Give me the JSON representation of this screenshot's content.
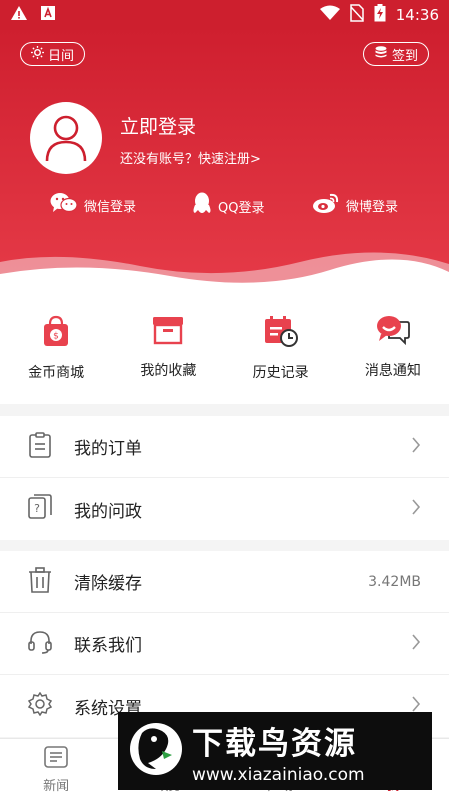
{
  "status_bar": {
    "time": "14:36"
  },
  "header": {
    "day_mode_label": "日间",
    "sign_in_label": "签到",
    "login_title": "立即登录",
    "register_prompt": "还没有账号？快速注册>",
    "social": [
      {
        "icon": "wechat-icon",
        "label": "微信登录"
      },
      {
        "icon": "qq-icon",
        "label": "QQ登录"
      },
      {
        "icon": "weibo-icon",
        "label": "微博登录"
      }
    ]
  },
  "shortcuts": [
    {
      "icon": "gold-shop-icon",
      "label": "金币商城"
    },
    {
      "icon": "favorites-icon",
      "label": "我的收藏"
    },
    {
      "icon": "history-icon",
      "label": "历史记录"
    },
    {
      "icon": "message-icon",
      "label": "消息通知"
    }
  ],
  "menu": {
    "orders": "我的订单",
    "inquiry": "我的问政",
    "clear_cache": "清除缓存",
    "cache_size": "3.42MB",
    "contact": "联系我们",
    "settings": "系统设置"
  },
  "bottom_nav": [
    {
      "icon": "news-icon",
      "label": "新闻"
    },
    {
      "icon": "gov-icon",
      "label": "政务"
    },
    {
      "icon": "square-icon",
      "label": "广场"
    },
    {
      "icon": "me-icon",
      "label": "我"
    }
  ],
  "watermark": {
    "title": "下载鸟资源",
    "url": "www.xiazainiao.com"
  },
  "colors": {
    "brand_red": "#cd1f2e"
  }
}
